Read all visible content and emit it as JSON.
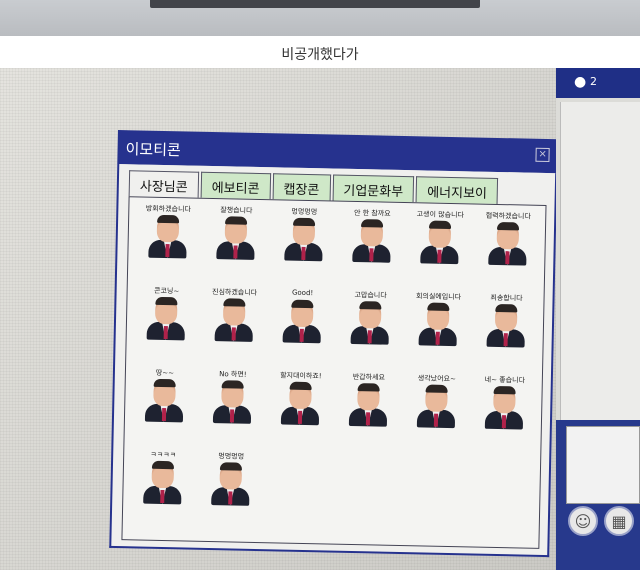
{
  "caption": "비공개했다가",
  "chat_panel": {
    "user_count": "2"
  },
  "emoticon_window": {
    "title": "이모티콘",
    "close_symbol": "×",
    "tabs": [
      "사장님콘",
      "에보티콘",
      "캡장콘",
      "기업문화부",
      "에너지보이"
    ],
    "active_tab": 0,
    "emoticons": [
      "방회하겠습니다",
      "잘챙습니다",
      "멍멍멍멍",
      "안 한 참까요",
      "고생이 많습니다",
      "협력하겠습니다",
      "콘코닝~",
      "진심하겠습니다",
      "Good!",
      "고맙습니다",
      "회의실에입니다",
      "죄송합니다",
      "땅~~",
      "No 하면!",
      "할지대이하죠!",
      "반갑하세요",
      "생각났어요~",
      "네~ 좋습니다",
      "ㅋㅋㅋㅋ",
      "멍멍멍멍"
    ]
  }
}
